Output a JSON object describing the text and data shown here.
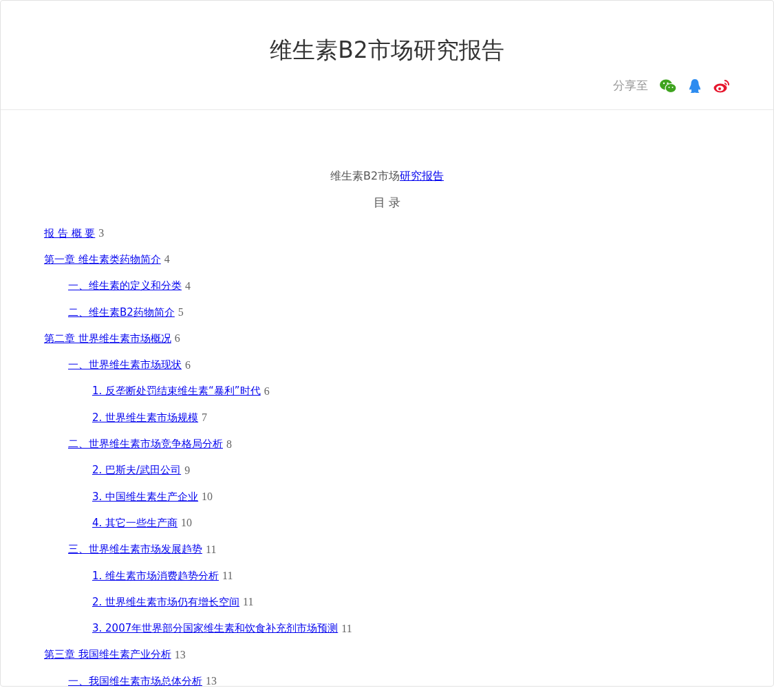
{
  "header": {
    "title": "维生素B2市场研究报告",
    "share_label": "分享至"
  },
  "document": {
    "subtitle": {
      "text": "维生素B2市场",
      "link": "研究报告"
    },
    "toc_heading": "目 录",
    "toc": [
      {
        "title": "报 告 概 要",
        "page": "3"
      },
      {
        "title": "第一章 维生素类药物简介",
        "page": "4",
        "children": [
          {
            "title": "一、维生素的定义和分类",
            "page": "4"
          },
          {
            "title": "二、维生素B2药物简介",
            "page": "5"
          }
        ]
      },
      {
        "title": "第二章 世界维生素市场概况",
        "page": "6",
        "children": [
          {
            "title": "一、世界维生素市场现状",
            "page": "6",
            "children": [
              {
                "title": "1. 反垄断处罚结束维生素“暴利”时代",
                "page": "6"
              },
              {
                "title": "2. 世界维生素市场规模",
                "page": "7"
              }
            ]
          },
          {
            "title": "二、世界维生素市场竞争格局分析",
            "page": "8",
            "children": [
              {
                "title": "2. 巴斯夫/武田公司",
                "page": "9"
              },
              {
                "title": "3. 中国维生素生产企业",
                "page": "10"
              },
              {
                "title": "4. 其它一些生产商",
                "page": "10"
              }
            ]
          },
          {
            "title": "三、世界维生素市场发展趋势",
            "page": "11",
            "children": [
              {
                "title": "1. 维生素市场消费趋势分析",
                "page": "11"
              },
              {
                "title": "2. 世界维生素市场仍有增长空间",
                "page": "11"
              },
              {
                "title": "3. 2007年世界部分国家维生素和饮食补充剂市场预测",
                "page": "11"
              }
            ]
          }
        ]
      },
      {
        "title": "第三章 我国维生素产业分析",
        "page": "13",
        "children": [
          {
            "title": "一、我国维生素市场总体分析",
            "page": "13"
          }
        ]
      }
    ]
  }
}
